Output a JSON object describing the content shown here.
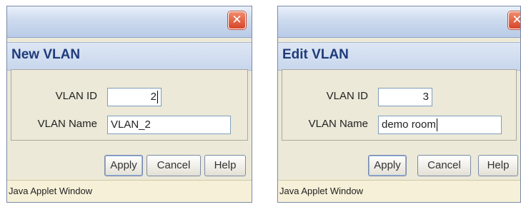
{
  "dialogs": [
    {
      "title": "New VLAN",
      "close_glyph": "✕",
      "vlan_id_label": "VLAN ID",
      "vlan_id_value": "2",
      "vlan_name_label": "VLAN Name",
      "vlan_name_value": "VLAN_2",
      "buttons": {
        "apply": "Apply",
        "cancel": "Cancel",
        "help": "Help"
      },
      "status": "Java Applet Window"
    },
    {
      "title": "Edit VLAN",
      "close_glyph": "✕",
      "vlan_id_label": "VLAN ID",
      "vlan_id_value": "3",
      "vlan_name_label": "VLAN Name",
      "vlan_name_value": "demo room",
      "buttons": {
        "apply": "Apply",
        "cancel": "Cancel",
        "help": "Help"
      },
      "status": "Java Applet Window"
    }
  ],
  "icons": {
    "close": "close-icon"
  },
  "colors": {
    "title_text": "#1f3b7a",
    "close_button": "#d6452a",
    "dialog_body": "#ece9d8",
    "status_bar": "#f6f0d8"
  }
}
